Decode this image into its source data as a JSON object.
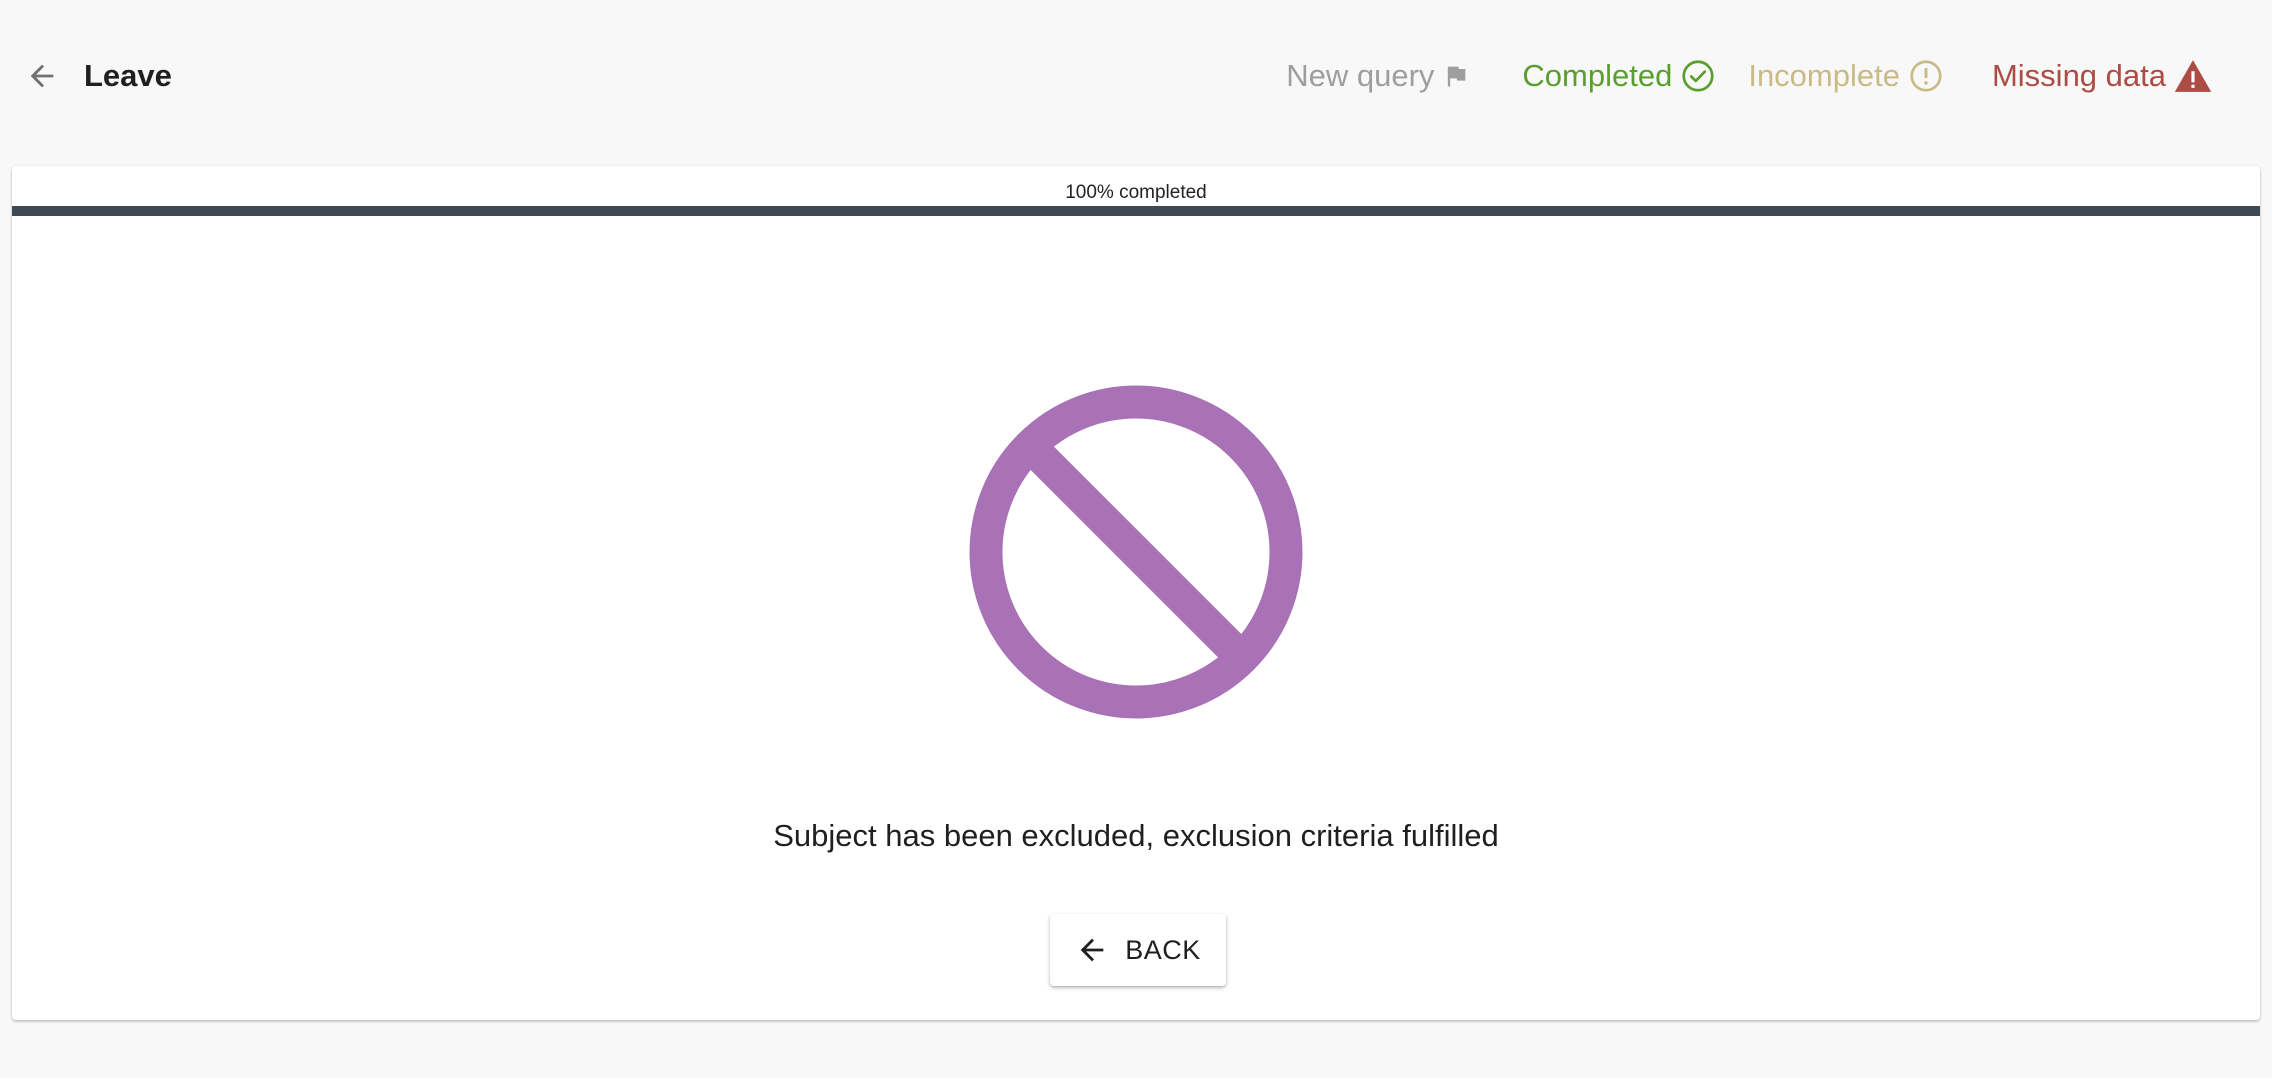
{
  "header": {
    "title": "Leave",
    "back_icon": "arrow-left-icon"
  },
  "status_legend": {
    "new_query": {
      "label": "New query",
      "icon": "flag-icon",
      "color": "#9e9e9e"
    },
    "completed": {
      "label": "Completed",
      "icon": "check-circle-icon",
      "color": "#5a9e2f"
    },
    "incomplete": {
      "label": "Incomplete",
      "icon": "exclamation-circle-icon",
      "color": "#c9bb86"
    },
    "missing_data": {
      "label": "Missing data",
      "icon": "warning-triangle-icon",
      "color": "#ad4b45"
    }
  },
  "progress": {
    "label": "100% completed",
    "value_percent": 100,
    "bar_color": "#3e4a52"
  },
  "main": {
    "icon": "no-entry-icon",
    "icon_color": "#a972b7",
    "message": "Subject has been excluded, exclusion criteria fulfilled",
    "back_button": {
      "label": "BACK",
      "icon": "arrow-left-icon"
    }
  }
}
